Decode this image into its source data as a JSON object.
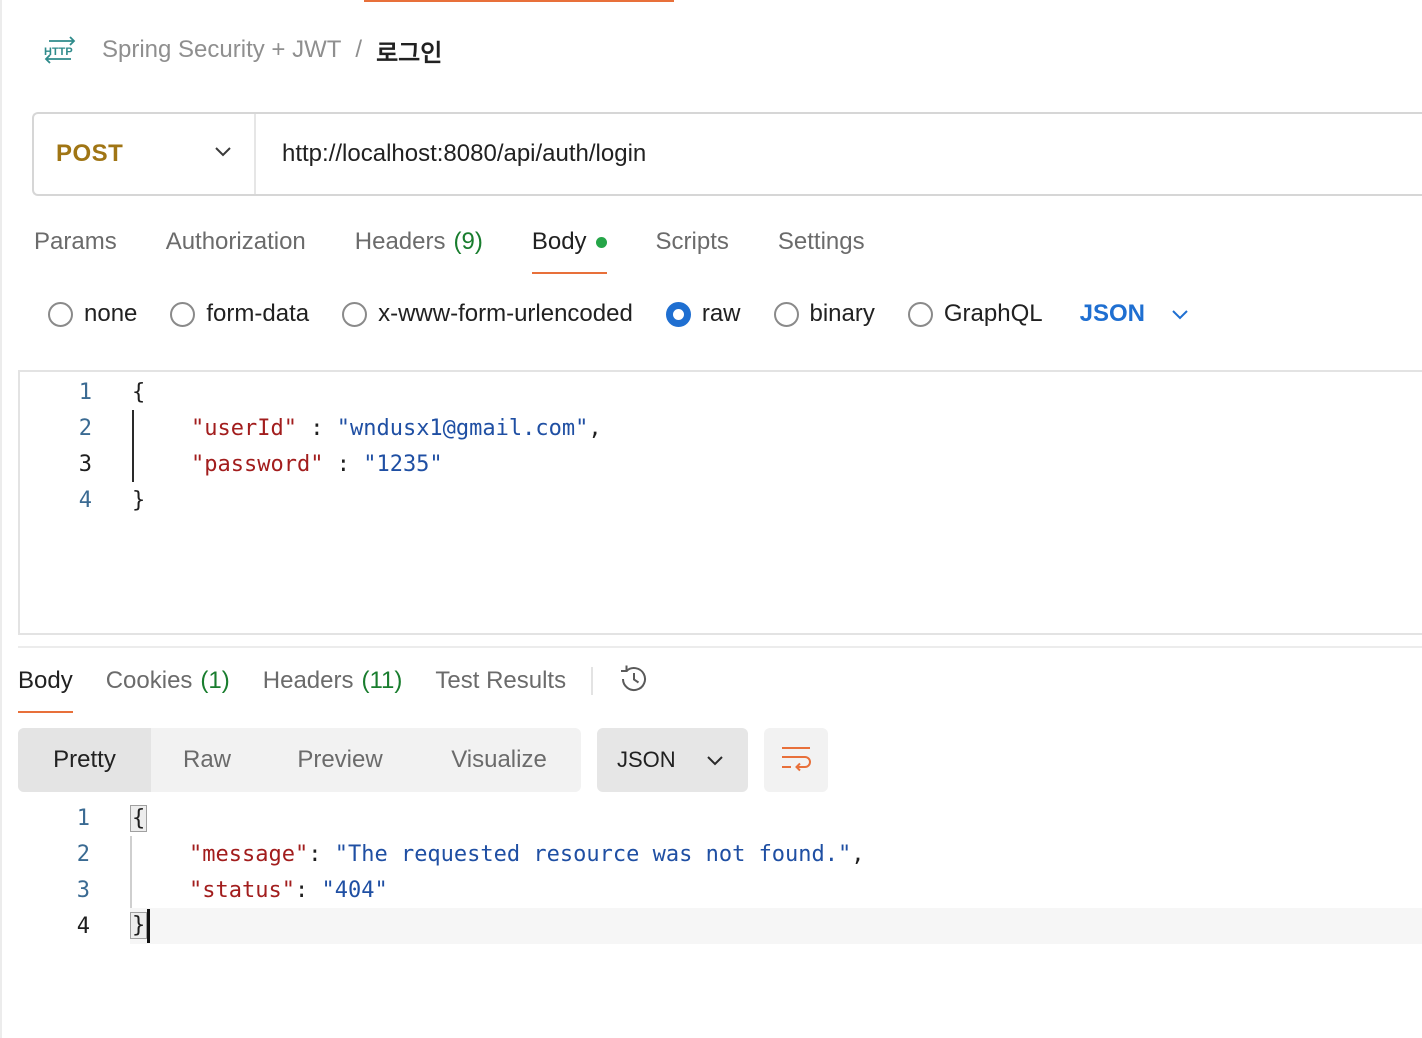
{
  "breadcrumb": {
    "icon": "http-request-icon",
    "icon_text": "HTTP",
    "collection": "Spring Security + JWT",
    "separator": "/",
    "request": "로그인"
  },
  "request": {
    "method": "POST",
    "url": "http://localhost:8080/api/auth/login"
  },
  "request_tabs": [
    {
      "label": "Params"
    },
    {
      "label": "Authorization"
    },
    {
      "label": "Headers",
      "count": "(9)"
    },
    {
      "label": "Body",
      "active": true
    },
    {
      "label": "Scripts"
    },
    {
      "label": "Settings"
    }
  ],
  "body_types": {
    "options": [
      "none",
      "form-data",
      "x-www-form-urlencoded",
      "raw",
      "binary",
      "GraphQL"
    ],
    "selected": "raw",
    "language": "JSON"
  },
  "request_body": {
    "line_numbers": [
      "1",
      "2",
      "3",
      "4"
    ],
    "open": "{",
    "close": "}",
    "key1": "\"userId\"",
    "sep1": " : ",
    "val1": "\"wndusx1@gmail.com\"",
    "comma": ",",
    "key2": "\"password\"",
    "sep2": " : ",
    "val2": "\"1235\""
  },
  "response_tabs": [
    {
      "label": "Body",
      "active": true
    },
    {
      "label": "Cookies",
      "count": "(1)"
    },
    {
      "label": "Headers",
      "count": "(11)"
    },
    {
      "label": "Test Results"
    }
  ],
  "view_modes": [
    "Pretty",
    "Raw",
    "Preview",
    "Visualize"
  ],
  "view_selected": "Pretty",
  "response_format": "JSON",
  "response_body": {
    "line_numbers": [
      "1",
      "2",
      "3",
      "4"
    ],
    "open": "{",
    "close": "}",
    "key1": "\"message\"",
    "sep1": ": ",
    "val1": "\"The requested resource was not found.\"",
    "comma": ",",
    "key2": "\"status\"",
    "sep2": ": ",
    "val2": "\"404\""
  },
  "colors": {
    "accent": "#e8703a",
    "method_post": "#a07514",
    "link_blue": "#1f6fd1",
    "count_green": "#197d2e",
    "json_key": "#a21d1d",
    "json_string": "#1f4fa3"
  }
}
